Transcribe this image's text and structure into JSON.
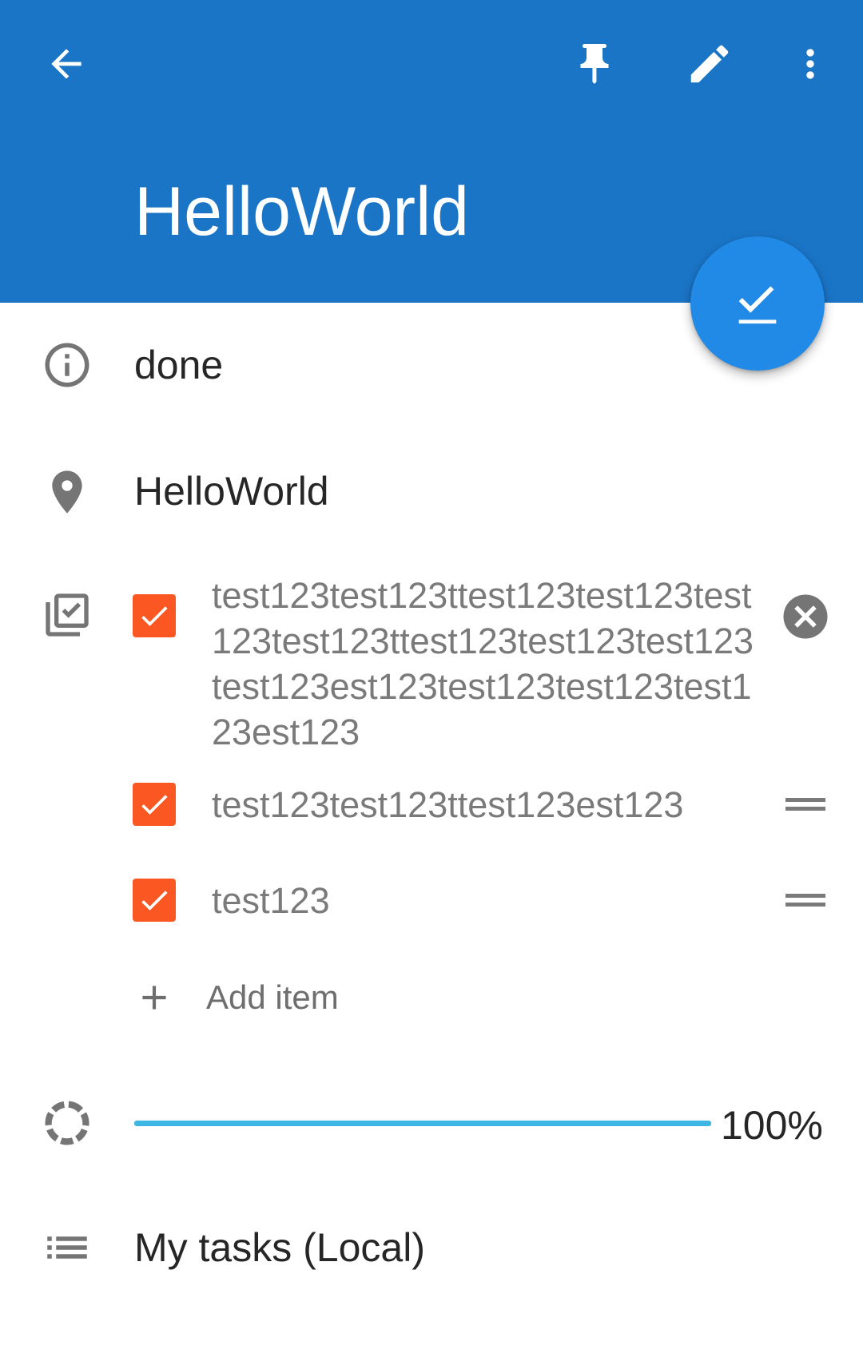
{
  "colors": {
    "appbar": "#1b75c7",
    "fab": "#2189e6",
    "checkbox": "#fb5722",
    "progress": "#3eb6e3",
    "icon_gray": "#757575"
  },
  "toolbar": {
    "back_icon": "arrow-back-icon",
    "pin_icon": "pin-icon",
    "edit_icon": "pencil-icon",
    "more_icon": "more-vert-icon",
    "title": "HelloWorld"
  },
  "fab": {
    "icon": "done-icon"
  },
  "status": {
    "icon": "info-icon",
    "value": "done"
  },
  "location": {
    "icon": "location-pin-icon",
    "value": "HelloWorld"
  },
  "checklist": {
    "icon": "checklist-icon",
    "items": [
      {
        "text": "test123test123ttest123test123test123test123ttest123test123test123test123est123test123test123test123est123",
        "checked": true,
        "action": "remove"
      },
      {
        "text": "test123test123ttest123est123",
        "checked": true,
        "action": "drag"
      },
      {
        "text": "test123",
        "checked": true,
        "action": "drag"
      }
    ],
    "add_label": "Add item"
  },
  "progress": {
    "icon": "progress-icon",
    "value": 1.0,
    "label": "100%"
  },
  "list": {
    "icon": "list-icon",
    "value": "My tasks (Local)"
  }
}
